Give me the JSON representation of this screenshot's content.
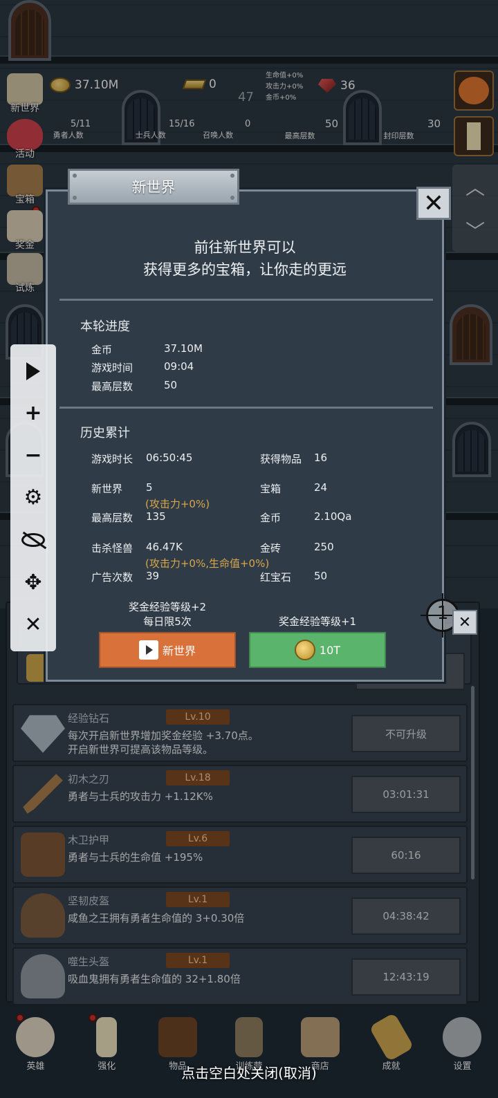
{
  "hud": {
    "gold": "37.10M",
    "gold_bars": "0",
    "floor_center": "47",
    "stat_bonus_lines": [
      "生命值+0%",
      "攻击力+0%",
      "金币+0%"
    ],
    "rubies": "36",
    "heroes": {
      "value": "5/11",
      "label": "勇者人数"
    },
    "soldiers": {
      "value": "15/16",
      "label": "士兵人数"
    },
    "summons": {
      "value": "0",
      "label": "召唤人数"
    },
    "max_floor": {
      "value": "50",
      "label": "最高层数"
    },
    "sealed_floor": {
      "value": "30",
      "label": "封印层数"
    }
  },
  "side_menu": [
    "新世界",
    "活动",
    "宝箱",
    "奖金",
    "试炼"
  ],
  "modal": {
    "title": "新世界",
    "desc_line1": "前往新世界可以",
    "desc_line2": "获得更多的宝箱，让你走的更远",
    "round": {
      "title": "本轮进度",
      "gold_label": "金币",
      "gold": "37.10M",
      "time_label": "游戏时间",
      "time": "09:04",
      "floor_label": "最高层数",
      "floor": "50"
    },
    "history": {
      "title": "历史累计",
      "playtime_label": "游戏时长",
      "playtime": "06:50:45",
      "items_label": "获得物品",
      "items": "16",
      "newworld_label": "新世界",
      "newworld": "5",
      "newworld_bonus": "(攻击力+0%)",
      "chest_label": "宝箱",
      "chest": "24",
      "maxfloor_label": "最高层数",
      "maxfloor": "135",
      "gold_label": "金币",
      "gold": "2.10Qa",
      "kills_label": "击杀怪兽",
      "kills": "46.47K",
      "goldbar_label": "金砖",
      "goldbar": "250",
      "kills_bonus": "(攻击力+0%,生命值+0%)",
      "ads_label": "广告次数",
      "ads": "39",
      "ruby_label": "红宝石",
      "ruby": "50"
    },
    "left_note_1": "奖金经验等级+2",
    "left_note_2": "每日限5次",
    "right_note": "奖金经验等级+1",
    "btn_newworld": "新世界",
    "btn_cost": "10T"
  },
  "crosshair_num": "1",
  "items": [
    {
      "name": "经验钻石",
      "level": "Lv.10",
      "desc": "每次开启新世界增加奖金经验 +3.70点。\n开启新世界可提高该物品等级。",
      "button": "不可升级"
    },
    {
      "name": "初木之刃",
      "level": "Lv.18",
      "desc": "勇者与士兵的攻击力 +1.12K%",
      "button": "03:01:31"
    },
    {
      "name": "木卫护甲",
      "level": "Lv.6",
      "desc": "勇者与士兵的生命值 +195%",
      "button": "60:16"
    },
    {
      "name": "坚韧皮盔",
      "level": "Lv.1",
      "desc": "咸鱼之王拥有勇者生命值的 3+0.30倍",
      "button": "04:38:42"
    },
    {
      "name": "噬生头盔",
      "level": "Lv.1",
      "desc": "吸血鬼拥有勇者生命值的 32+1.80倍",
      "button": "12:43:19"
    }
  ],
  "bottom_nav": [
    "英雄",
    "强化",
    "物品",
    "训练营",
    "商店",
    "成就",
    "设置"
  ],
  "close_hint": "点击空白处关闭(取消)"
}
